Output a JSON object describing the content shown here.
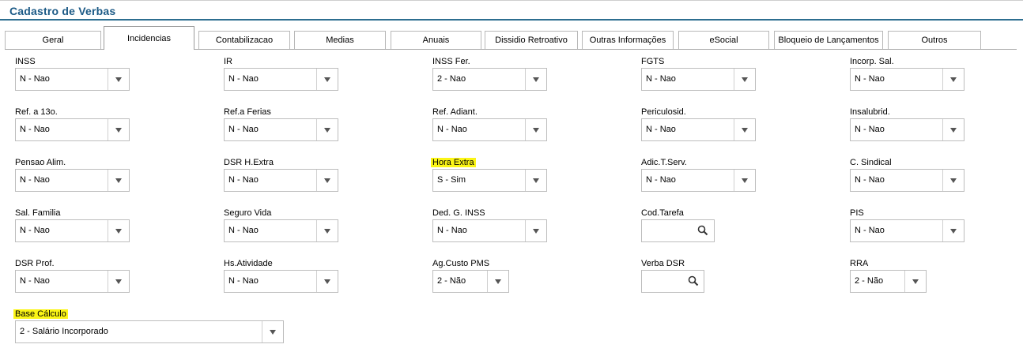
{
  "window": {
    "title": "Cadastro de Verbas"
  },
  "tabs": [
    {
      "label": "Geral"
    },
    {
      "label": "Incidencias",
      "active": true
    },
    {
      "label": "Contabilizacao"
    },
    {
      "label": "Medias"
    },
    {
      "label": "Anuais"
    },
    {
      "label": "Dissidio Retroativo"
    },
    {
      "label": "Outras Informações"
    },
    {
      "label": "eSocial"
    },
    {
      "label": "Bloqueio de Lançamentos"
    },
    {
      "label": "Outros"
    }
  ],
  "fields": {
    "inss": {
      "label": "INSS",
      "value": "N - Nao"
    },
    "ir": {
      "label": "IR",
      "value": "N - Nao"
    },
    "inss_fer": {
      "label": "INSS Fer.",
      "value": "2 - Nao"
    },
    "fgts": {
      "label": "FGTS",
      "value": "N - Nao"
    },
    "incorp_sal": {
      "label": "Incorp. Sal.",
      "value": "N - Nao"
    },
    "ref_13": {
      "label": "Ref. a 13o.",
      "value": "N - Nao"
    },
    "ref_ferias": {
      "label": "Ref.a Ferias",
      "value": "N - Nao"
    },
    "ref_adiant": {
      "label": "Ref. Adiant.",
      "value": "N - Nao"
    },
    "periculosid": {
      "label": "Periculosid.",
      "value": "N - Nao"
    },
    "insalubrid": {
      "label": "Insalubrid.",
      "value": "N - Nao"
    },
    "pensao_alim": {
      "label": "Pensao Alim.",
      "value": "N - Nao"
    },
    "dsr_hextra": {
      "label": "DSR H.Extra",
      "value": "N - Nao"
    },
    "hora_extra": {
      "label": "Hora Extra",
      "value": "S - Sim"
    },
    "adic_tserv": {
      "label": "Adic.T.Serv.",
      "value": "N - Nao"
    },
    "c_sindical": {
      "label": "C. Sindical",
      "value": "N - Nao"
    },
    "sal_familia": {
      "label": "Sal. Familia",
      "value": "N - Nao"
    },
    "seguro_vida": {
      "label": "Seguro Vida",
      "value": "N - Nao"
    },
    "ded_g_inss": {
      "label": "Ded. G. INSS",
      "value": "N - Nao"
    },
    "cod_tarefa": {
      "label": "Cod.Tarefa",
      "value": ""
    },
    "pis": {
      "label": "PIS",
      "value": "N - Nao"
    },
    "dsr_prof": {
      "label": "DSR Prof.",
      "value": "N - Nao"
    },
    "hs_atividade": {
      "label": "Hs.Atividade",
      "value": "N - Nao"
    },
    "ag_custo_pms": {
      "label": "Ag.Custo PMS",
      "value": "2 - Não"
    },
    "verba_dsr": {
      "label": "Verba DSR",
      "value": ""
    },
    "rra": {
      "label": "RRA",
      "value": "2 - Não"
    },
    "base_calculo": {
      "label": "Base Cálculo",
      "value": "2 - Salário Incorporado"
    }
  },
  "colors": {
    "title": "#1c5a86",
    "highlight": "#fbf516",
    "rule": "#2d6e90"
  },
  "icons": {
    "dropdown": "chevron-down-icon",
    "lookup": "search-icon"
  }
}
